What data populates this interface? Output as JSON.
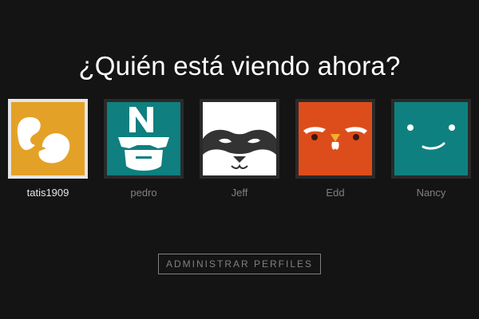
{
  "page": {
    "title": "¿Quién está viendo ahora?"
  },
  "profiles": [
    {
      "name": "tatis1909",
      "icon": "yellow-blob-face-icon",
      "color": "#e4a127",
      "selected": true
    },
    {
      "name": "pedro",
      "icon": "masked-n-face-icon",
      "color": "#0f7f7f",
      "selected": false
    },
    {
      "name": "Jeff",
      "icon": "masked-dog-face-icon",
      "color": "#ffffff",
      "selected": false
    },
    {
      "name": "Edd",
      "icon": "chicken-face-icon",
      "color": "#dd4d1b",
      "selected": false
    },
    {
      "name": "Nancy",
      "icon": "smiley-face-icon",
      "color": "#0f8080",
      "selected": false
    }
  ],
  "manage_button": {
    "label": "ADMINISTRAR PERFILES"
  }
}
